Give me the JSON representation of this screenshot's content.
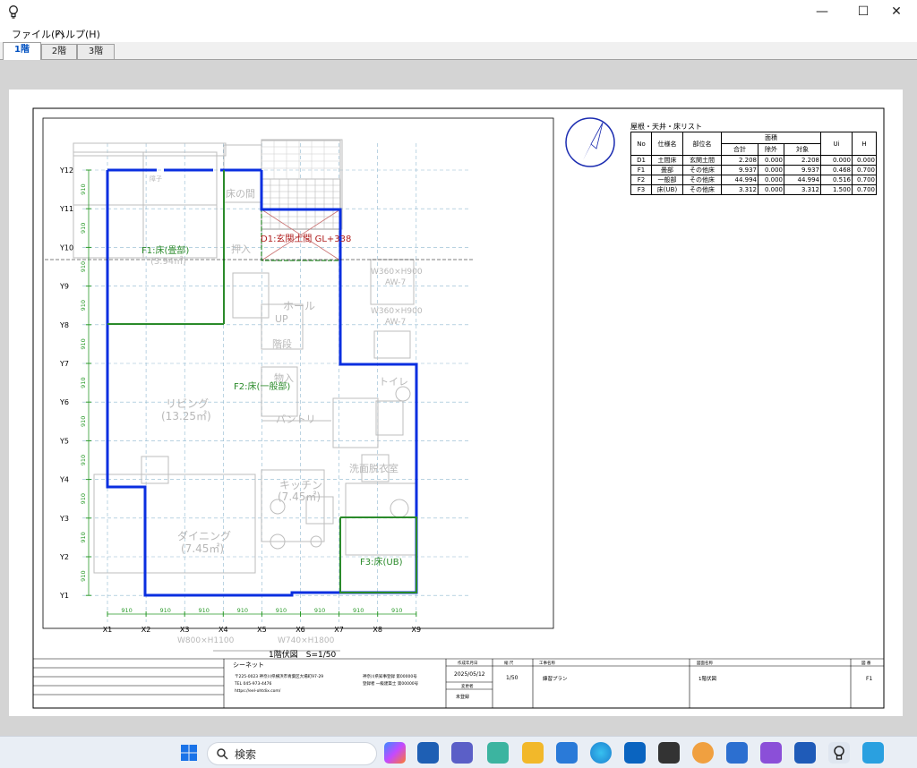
{
  "window": {
    "minimize_glyph": "—",
    "maximize_glyph": "☐",
    "close_glyph": "✕",
    "icon": "lightbulb-icon"
  },
  "menu": {
    "file": "ファイル(F)",
    "help": "ヘルプ(H)"
  },
  "tabs": [
    {
      "label": "1階",
      "active": true
    },
    {
      "label": "2階",
      "active": false
    },
    {
      "label": "3階",
      "active": false
    }
  ],
  "drawing": {
    "row_labels": [
      "Y12",
      "Y11",
      "Y10",
      "Y9",
      "Y8",
      "Y7",
      "Y6",
      "Y5",
      "Y4",
      "Y3",
      "Y2",
      "Y1"
    ],
    "row_dims": [
      "910",
      "910",
      "910",
      "910",
      "910",
      "910",
      "910",
      "910",
      "910",
      "910",
      "910"
    ],
    "col_labels": [
      "X1",
      "X2",
      "X3",
      "X4",
      "X5",
      "X6",
      "X7",
      "X8",
      "X9"
    ],
    "col_dims": [
      "910",
      "910",
      "910",
      "910",
      "910",
      "910",
      "910",
      "910"
    ],
    "rooms": {
      "washitsu_label": "F1:床(畳部)",
      "washitsu_area": "(3.94㎡)",
      "genkan_label": "D1:玄関土間 GL+338",
      "floor_label": "F2:床(一般部)",
      "bath_label": "F3:床(UB)",
      "living": "リビング",
      "living_area": "(13.25㎡)",
      "dining": "ダイニング",
      "dining_area": "(7.45㎡)",
      "kitchen": "キッチン",
      "kitchen_area": "(7.45㎡)",
      "hall": "ホール",
      "up": "UP",
      "stairs": "階段",
      "pantry": "パントリ",
      "storage": "物入",
      "oshiire": "押入",
      "toilet": "トイレ",
      "senmen": "洗面脱衣室",
      "tokonoma": "床の間",
      "shoji": "障子",
      "window1": "W360×H900",
      "window1_code": "AW-7",
      "window2": "W360×H900",
      "window2_code": "AW-7",
      "window3": "W800×H1100",
      "window4": "W740×H1800",
      "scale_top": "S=1/50"
    },
    "caption": "1階伏図　S=1/50"
  },
  "table": {
    "title": "屋根・天井・床リスト",
    "headers": {
      "no": "No",
      "spec": "仕様名",
      "part": "部位名",
      "area": "面積",
      "total": "合計",
      "excluded": "除外",
      "target": "対象",
      "ui": "Ui",
      "h": "H"
    },
    "rows": [
      {
        "no": "D1",
        "spec": "土間床",
        "part": "玄関土間",
        "total": "2.208",
        "excluded": "0.000",
        "target": "2.208",
        "ui": "0.000",
        "h": "0.000"
      },
      {
        "no": "F1",
        "spec": "畳部",
        "part": "その他床",
        "total": "9.937",
        "excluded": "0.000",
        "target": "9.937",
        "ui": "0.468",
        "h": "0.700"
      },
      {
        "no": "F2",
        "spec": "一般部",
        "part": "その他床",
        "total": "44.994",
        "excluded": "0.000",
        "target": "44.994",
        "ui": "0.516",
        "h": "0.700"
      },
      {
        "no": "F3",
        "spec": "床(UB)",
        "part": "その他床",
        "total": "3.312",
        "excluded": "0.000",
        "target": "3.312",
        "ui": "1.500",
        "h": "0.700"
      }
    ]
  },
  "titleblock": {
    "company": "シーネット",
    "address": "〒225-0023 神奈川県横浜市青葉区大場町97-29",
    "tel": "TEL 045-973-4476",
    "url": "https://eel-ohtdix.com/",
    "license1": "神奈川県知事登録 第00000号",
    "license2": "登録者 一級建築士 第00000号",
    "date_label": "作成年月日",
    "date": "2025/05/12",
    "revised_label": "変更者",
    "designer": "未登録",
    "scale_label": "縮 尺",
    "scale": "1/50",
    "project_label": "工事名称",
    "project": "練習プラン",
    "drawing_name_label": "図面名称",
    "drawing_name": "1階伏図",
    "number_label": "図 番",
    "number": "F1"
  },
  "taskbar": {
    "search_placeholder": "検索"
  }
}
